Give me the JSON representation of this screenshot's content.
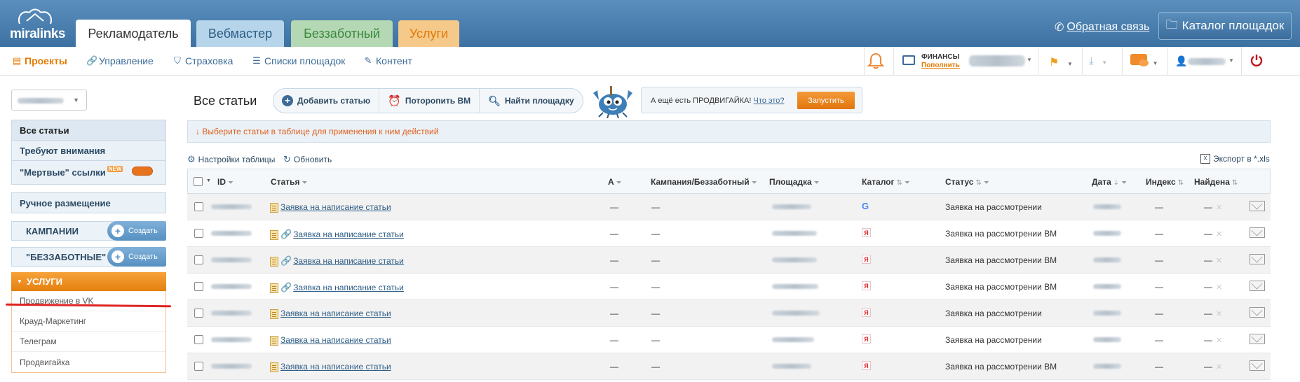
{
  "header": {
    "logo": "miralinks",
    "tabs": [
      {
        "label": "Рекламодатель"
      },
      {
        "label": "Вебмастер"
      },
      {
        "label": "Беззаботный"
      },
      {
        "label": "Услуги"
      }
    ],
    "feedback": "Обратная связь",
    "catalog": "Каталог площадок"
  },
  "subnav": {
    "items": [
      {
        "label": "Проекты",
        "icon": "projects-icon"
      },
      {
        "label": "Управление",
        "icon": "link-icon"
      },
      {
        "label": "Страховка",
        "icon": "shield-icon"
      },
      {
        "label": "Списки площадок",
        "icon": "list-icon"
      },
      {
        "label": "Контент",
        "icon": "edit-icon"
      }
    ],
    "finance_title": "ФИНАНСЫ",
    "finance_link": "Пополнить"
  },
  "sidebar": {
    "menu": [
      {
        "label": "Все статьи"
      },
      {
        "label": "Требуют внимания"
      },
      {
        "label": "\"Мертвые\" ссылки",
        "badge": "NEW"
      }
    ],
    "manual": "Ручное размещение",
    "campaigns": "КАМПАНИИ",
    "carefree": "\"БЕЗЗАБОТНЫЕ\"",
    "create": "Создать",
    "services_title": "УСЛУГИ",
    "services": [
      {
        "label": "Продвижение в VK"
      },
      {
        "label": "Крауд-Маркетинг"
      },
      {
        "label": "Телеграм"
      },
      {
        "label": "Продвигайка"
      }
    ]
  },
  "main": {
    "title": "Все статьи",
    "actions": {
      "add": "Добавить статью",
      "hurry": "Поторопить ВМ",
      "find": "Найти площадку"
    },
    "promo": {
      "text": "А ещё есть ПРОДВИГАЙКА!",
      "question": "Что это?",
      "button": "Запустить"
    },
    "hint": "↓ Выберите статьи в таблице для применения к ним действий",
    "table_settings": "Настройки таблицы",
    "refresh": "Обновить",
    "export": "Экспорт в *.xls"
  },
  "table": {
    "columns": {
      "id": "ID",
      "article": "Статья",
      "a": "А",
      "campaign": "Кампания/Беззаботный",
      "site": "Площадка",
      "catalog": "Каталог",
      "status": "Статус",
      "date": "Дата",
      "index": "Индекс",
      "found": "Найдена"
    },
    "dash": "—",
    "rows": [
      {
        "article": "Заявка на написание статьи",
        "link": false,
        "catalog": "google",
        "status": "Заявка на рассмотрении"
      },
      {
        "article": "Заявка на написание статьи",
        "link": true,
        "catalog": "yandex",
        "status": "Заявка на рассмотрении ВМ"
      },
      {
        "article": "Заявка на написание статьи",
        "link": true,
        "catalog": "yandex",
        "status": "Заявка на рассмотрении ВМ"
      },
      {
        "article": "Заявка на написание статьи",
        "link": true,
        "catalog": "yandex",
        "status": "Заявка на рассмотрении ВМ"
      },
      {
        "article": "Заявка на написание статьи",
        "link": false,
        "catalog": "yandex",
        "status": "Заявка на рассмотрении"
      },
      {
        "article": "Заявка на написание статьи",
        "link": false,
        "catalog": "yandex",
        "status": "Заявка на рассмотрении"
      },
      {
        "article": "Заявка на написание статьи",
        "link": false,
        "catalog": "yandex",
        "status": "Заявка на рассмотрении ВМ"
      }
    ]
  }
}
